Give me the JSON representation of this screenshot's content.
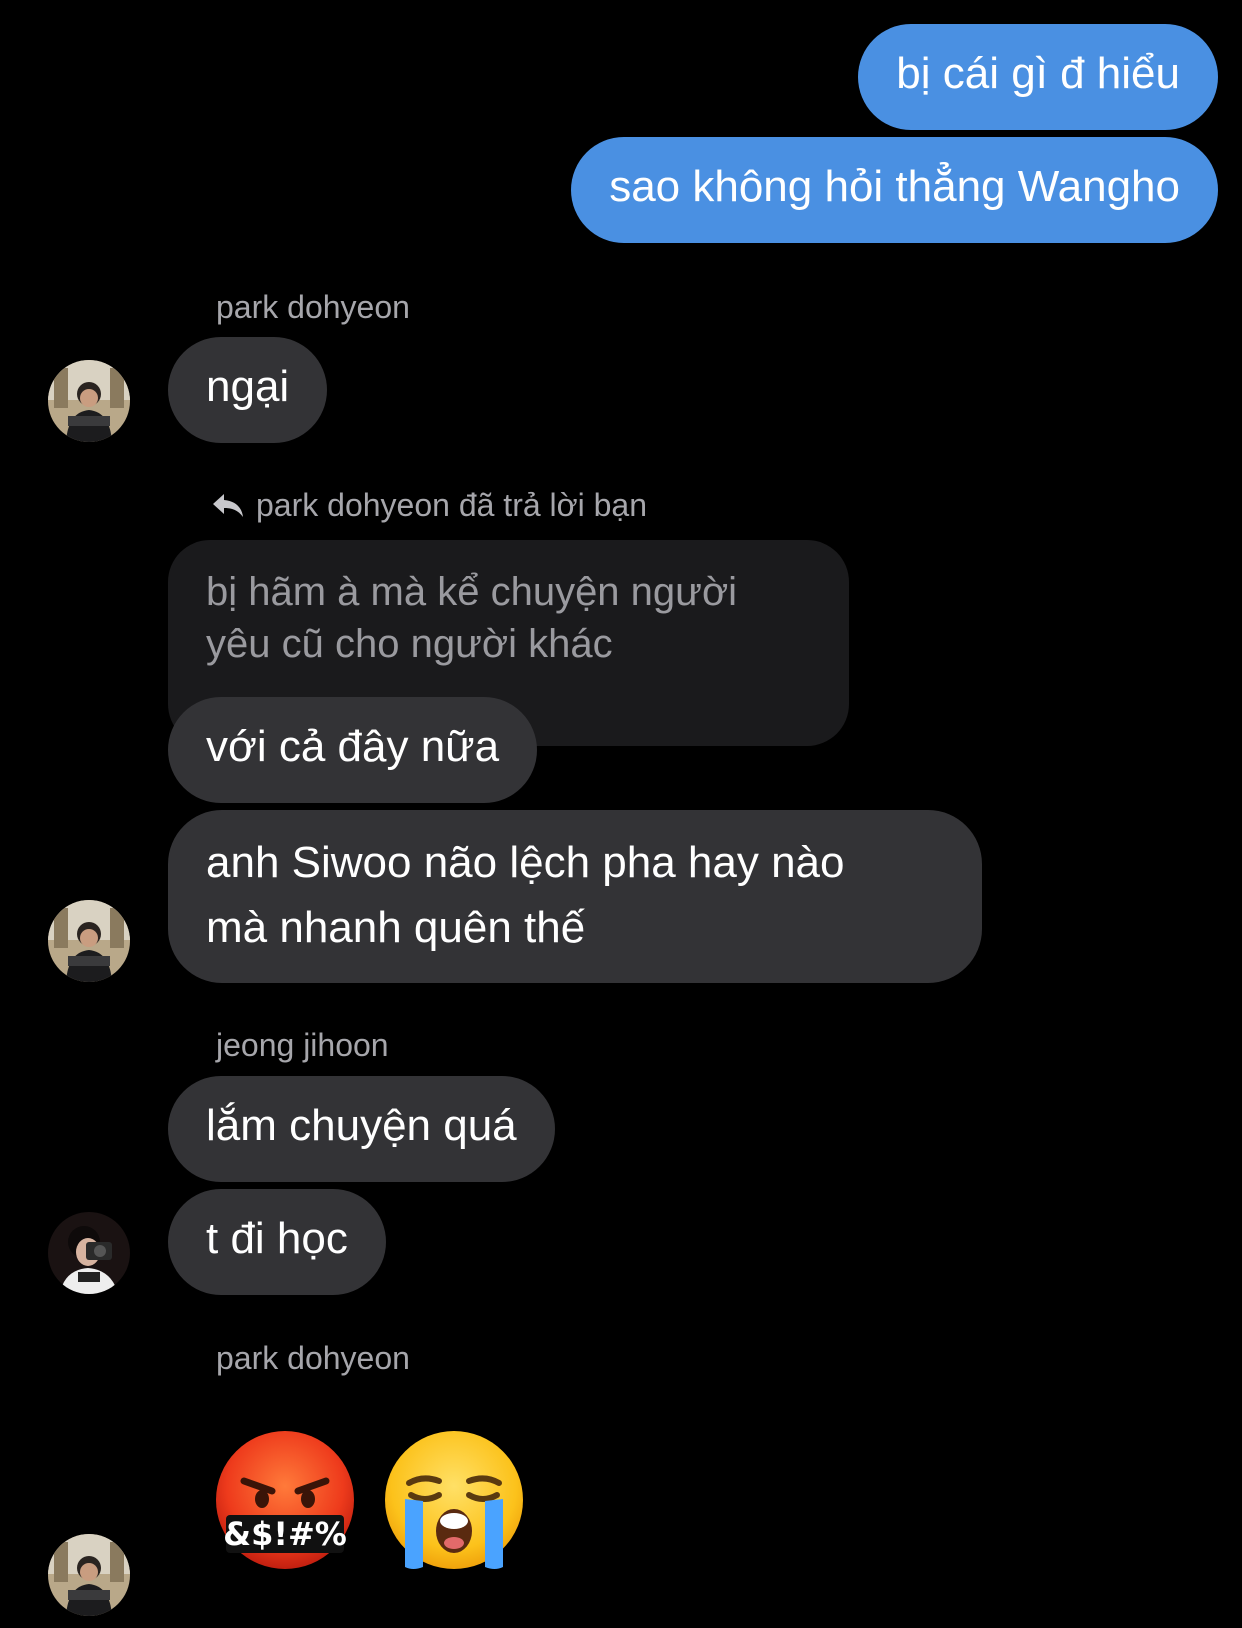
{
  "messages": {
    "out_1": "bị cái gì đ hiểu",
    "out_2": "sao không hỏi thẳng Wangho",
    "sender_1": "park dohyeon",
    "in_1": "ngại",
    "reply_label": "park dohyeon đã trả lời bạn",
    "quoted_text": "bị hãm à mà kể chuyện người yêu cũ cho người khác",
    "in_2": "với cả đây nữa",
    "in_3_line1": "anh Siwoo não lệch pha hay nào",
    "in_3_line2": "mà nhanh quên thế",
    "sender_2": "jeong jihoon",
    "in_4": "lắm chuyện quá",
    "in_5": "t đi học",
    "sender_3": "park dohyeon",
    "emoji_1_text": "&$!#%"
  },
  "icons": {
    "reply": "reply-arrow-icon",
    "emoji_1": "face-with-symbols-on-mouth-emoji",
    "emoji_2": "loudly-crying-face-emoji"
  },
  "colors": {
    "background": "#000000",
    "outgoing_bubble": "#4a90e2",
    "incoming_bubble": "#333336",
    "quoted_bubble": "#1a1a1c",
    "secondary_text": "#a6a6ab"
  }
}
